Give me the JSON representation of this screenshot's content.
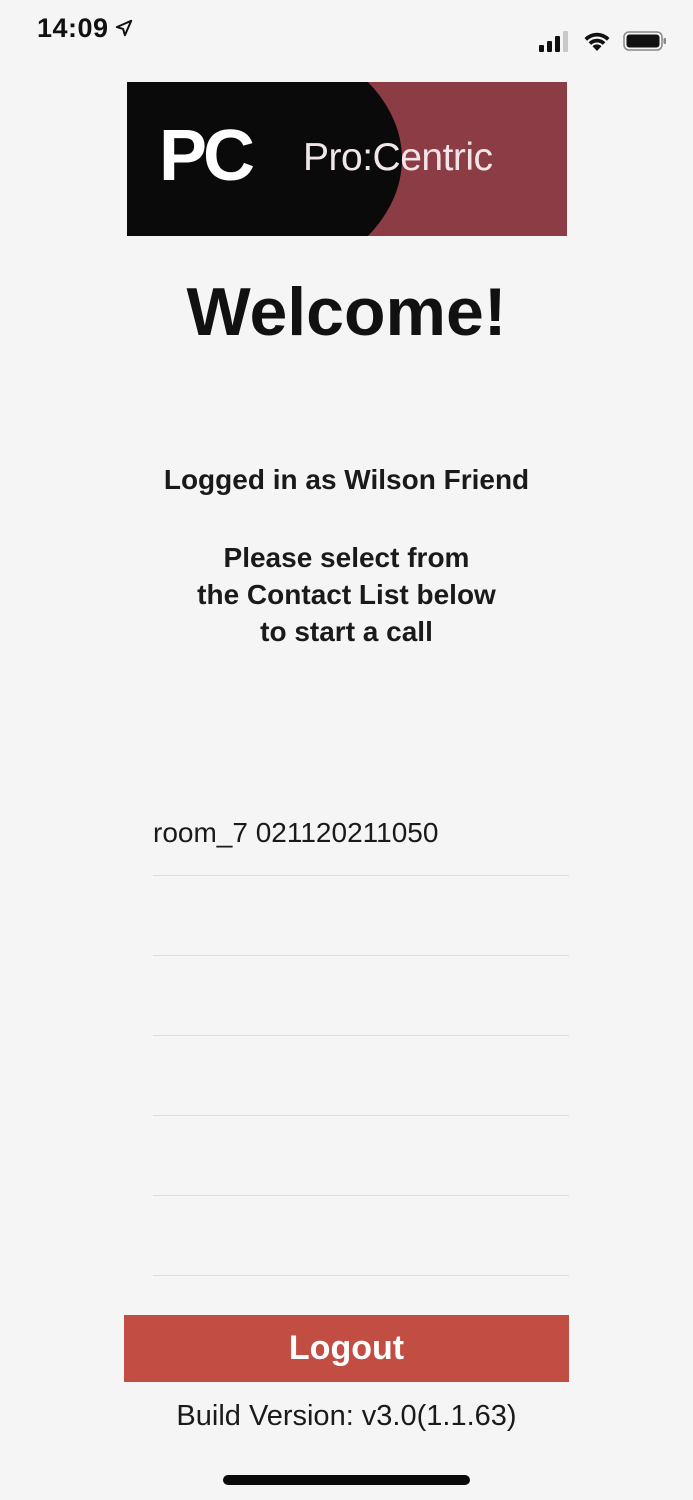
{
  "status_bar": {
    "time": "14:09",
    "icons": [
      "location-arrow-icon",
      "cellular-signal-icon",
      "wifi-icon",
      "battery-icon"
    ]
  },
  "logo": {
    "monogram": "PC",
    "brand_name": "Pro:Centric",
    "colors": {
      "dark": "#0a0a0a",
      "brand": "#8c3c45"
    }
  },
  "welcome": {
    "title": "Welcome!",
    "logged_in_text": "Logged in as Wilson Friend",
    "instruction_lines": [
      "Please select from",
      "the Contact List below",
      "to start a call"
    ]
  },
  "contacts": [
    {
      "label": "room_7 021120211050"
    },
    {
      "label": ""
    },
    {
      "label": ""
    },
    {
      "label": ""
    },
    {
      "label": ""
    },
    {
      "label": ""
    }
  ],
  "logout": {
    "label": "Logout",
    "color": "#c24e43"
  },
  "build_version": "Build Version: v3.0(1.1.63)"
}
